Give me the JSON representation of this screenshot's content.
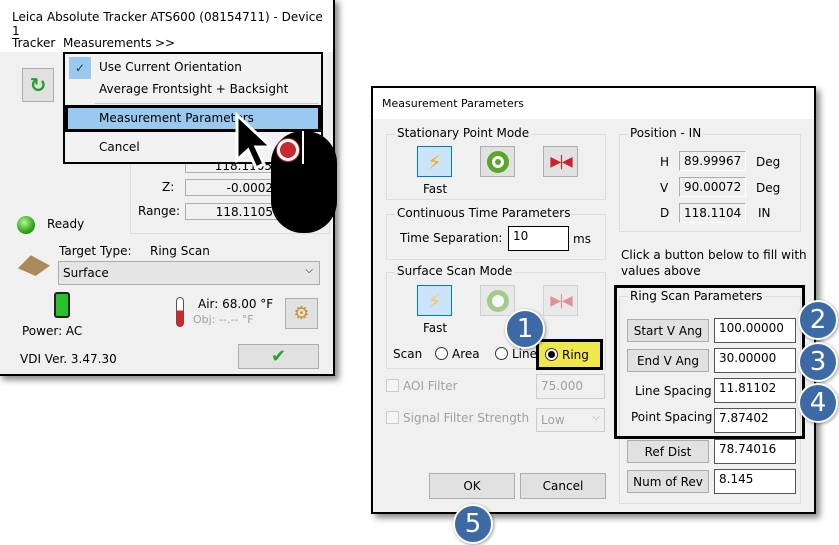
{
  "tracker_window": {
    "title": "Leica Absolute Tracker ATS600 (08154711) - Device 1",
    "menu": [
      "Tracker",
      "Measurements",
      ">>"
    ],
    "dropdown": {
      "items": [
        {
          "label": "Use Current Orientation",
          "checked": true
        },
        {
          "label": "Average Frontsight + Backsight"
        },
        {
          "label": "Measurement Parameters",
          "highlighted": true
        },
        {
          "label": "Cancel"
        }
      ]
    },
    "coords": {
      "y_value": "118.1105",
      "z_label": "Z:",
      "z_value": "-0.0002",
      "range_label": "Range:",
      "range_value": "118.1105"
    },
    "status": "Ready",
    "target_type_label": "Target Type:",
    "target_type_value": "Ring Scan",
    "target_select": "Surface",
    "power": "Power: AC",
    "air": "Air: 68.00 °F",
    "obj": "Obj: --.-- °F",
    "version": "VDI Ver. 3.47.30"
  },
  "dialog": {
    "title": "Measurement Parameters",
    "stationary": {
      "legend": "Stationary Point Mode",
      "fast_label": "Fast"
    },
    "continuous": {
      "legend": "Continuous Time Parameters",
      "time_label": "Time Separation:",
      "time_value": "10",
      "unit": "ms"
    },
    "surface": {
      "legend": "Surface Scan Mode",
      "fast_label": "Fast",
      "scan_label": "Scan",
      "options": [
        "Area",
        "Line",
        "Ring"
      ],
      "selected": "Ring"
    },
    "aoi": {
      "label": "AOI Filter",
      "value": "75.000",
      "checked": false
    },
    "signal": {
      "label": "Signal Filter Strength",
      "value": "Low",
      "checked": false
    },
    "ok": "OK",
    "cancel": "Cancel",
    "position": {
      "legend": "Position - IN",
      "rows": [
        {
          "axis": "H",
          "value": "89.99967",
          "unit": "Deg"
        },
        {
          "axis": "V",
          "value": "90.00072",
          "unit": "Deg"
        },
        {
          "axis": "D",
          "value": "118.1104",
          "unit": "IN"
        }
      ]
    },
    "hint": [
      "Click a button below to fill with",
      "values above"
    ],
    "ring": {
      "legend": "Ring Scan Parameters",
      "start_v": {
        "label": "Start V Ang",
        "value": "100.00000"
      },
      "end_v": {
        "label": "End V Ang",
        "value": "30.00000"
      },
      "line_spacing": {
        "label": "Line Spacing",
        "value": "11.81102"
      },
      "point_spacing": {
        "label": "Point Spacing",
        "value": "7.87402"
      },
      "ref_dist": {
        "label": "Ref Dist",
        "value": "78.74016"
      },
      "num_rev": {
        "label": "Num of Rev",
        "value": "8.145"
      }
    }
  },
  "callouts": [
    "1",
    "2",
    "3",
    "4",
    "5"
  ],
  "colors": {
    "highlight": "#99c9ef",
    "ring_highlight": "#f0e84a",
    "callout": "#3d6aa5"
  }
}
